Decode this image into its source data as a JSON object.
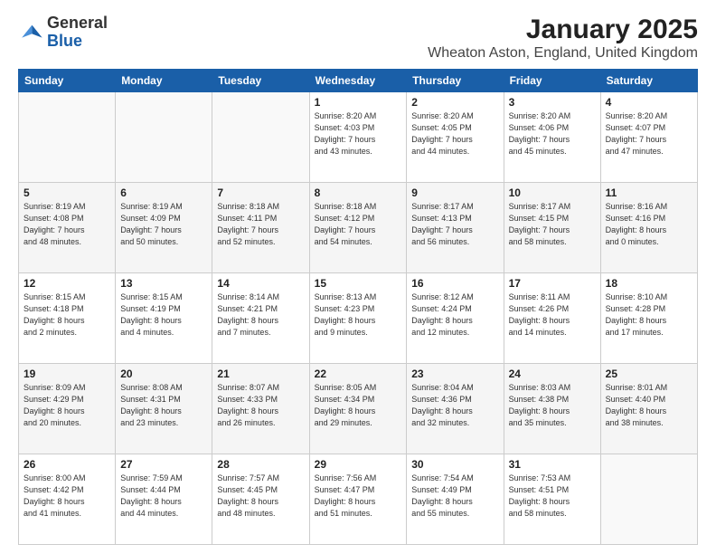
{
  "logo": {
    "general": "General",
    "blue": "Blue"
  },
  "header": {
    "month": "January 2025",
    "location": "Wheaton Aston, England, United Kingdom"
  },
  "weekdays": [
    "Sunday",
    "Monday",
    "Tuesday",
    "Wednesday",
    "Thursday",
    "Friday",
    "Saturday"
  ],
  "weeks": [
    [
      {
        "day": "",
        "info": ""
      },
      {
        "day": "",
        "info": ""
      },
      {
        "day": "",
        "info": ""
      },
      {
        "day": "1",
        "info": "Sunrise: 8:20 AM\nSunset: 4:03 PM\nDaylight: 7 hours\nand 43 minutes."
      },
      {
        "day": "2",
        "info": "Sunrise: 8:20 AM\nSunset: 4:05 PM\nDaylight: 7 hours\nand 44 minutes."
      },
      {
        "day": "3",
        "info": "Sunrise: 8:20 AM\nSunset: 4:06 PM\nDaylight: 7 hours\nand 45 minutes."
      },
      {
        "day": "4",
        "info": "Sunrise: 8:20 AM\nSunset: 4:07 PM\nDaylight: 7 hours\nand 47 minutes."
      }
    ],
    [
      {
        "day": "5",
        "info": "Sunrise: 8:19 AM\nSunset: 4:08 PM\nDaylight: 7 hours\nand 48 minutes."
      },
      {
        "day": "6",
        "info": "Sunrise: 8:19 AM\nSunset: 4:09 PM\nDaylight: 7 hours\nand 50 minutes."
      },
      {
        "day": "7",
        "info": "Sunrise: 8:18 AM\nSunset: 4:11 PM\nDaylight: 7 hours\nand 52 minutes."
      },
      {
        "day": "8",
        "info": "Sunrise: 8:18 AM\nSunset: 4:12 PM\nDaylight: 7 hours\nand 54 minutes."
      },
      {
        "day": "9",
        "info": "Sunrise: 8:17 AM\nSunset: 4:13 PM\nDaylight: 7 hours\nand 56 minutes."
      },
      {
        "day": "10",
        "info": "Sunrise: 8:17 AM\nSunset: 4:15 PM\nDaylight: 7 hours\nand 58 minutes."
      },
      {
        "day": "11",
        "info": "Sunrise: 8:16 AM\nSunset: 4:16 PM\nDaylight: 8 hours\nand 0 minutes."
      }
    ],
    [
      {
        "day": "12",
        "info": "Sunrise: 8:15 AM\nSunset: 4:18 PM\nDaylight: 8 hours\nand 2 minutes."
      },
      {
        "day": "13",
        "info": "Sunrise: 8:15 AM\nSunset: 4:19 PM\nDaylight: 8 hours\nand 4 minutes."
      },
      {
        "day": "14",
        "info": "Sunrise: 8:14 AM\nSunset: 4:21 PM\nDaylight: 8 hours\nand 7 minutes."
      },
      {
        "day": "15",
        "info": "Sunrise: 8:13 AM\nSunset: 4:23 PM\nDaylight: 8 hours\nand 9 minutes."
      },
      {
        "day": "16",
        "info": "Sunrise: 8:12 AM\nSunset: 4:24 PM\nDaylight: 8 hours\nand 12 minutes."
      },
      {
        "day": "17",
        "info": "Sunrise: 8:11 AM\nSunset: 4:26 PM\nDaylight: 8 hours\nand 14 minutes."
      },
      {
        "day": "18",
        "info": "Sunrise: 8:10 AM\nSunset: 4:28 PM\nDaylight: 8 hours\nand 17 minutes."
      }
    ],
    [
      {
        "day": "19",
        "info": "Sunrise: 8:09 AM\nSunset: 4:29 PM\nDaylight: 8 hours\nand 20 minutes."
      },
      {
        "day": "20",
        "info": "Sunrise: 8:08 AM\nSunset: 4:31 PM\nDaylight: 8 hours\nand 23 minutes."
      },
      {
        "day": "21",
        "info": "Sunrise: 8:07 AM\nSunset: 4:33 PM\nDaylight: 8 hours\nand 26 minutes."
      },
      {
        "day": "22",
        "info": "Sunrise: 8:05 AM\nSunset: 4:34 PM\nDaylight: 8 hours\nand 29 minutes."
      },
      {
        "day": "23",
        "info": "Sunrise: 8:04 AM\nSunset: 4:36 PM\nDaylight: 8 hours\nand 32 minutes."
      },
      {
        "day": "24",
        "info": "Sunrise: 8:03 AM\nSunset: 4:38 PM\nDaylight: 8 hours\nand 35 minutes."
      },
      {
        "day": "25",
        "info": "Sunrise: 8:01 AM\nSunset: 4:40 PM\nDaylight: 8 hours\nand 38 minutes."
      }
    ],
    [
      {
        "day": "26",
        "info": "Sunrise: 8:00 AM\nSunset: 4:42 PM\nDaylight: 8 hours\nand 41 minutes."
      },
      {
        "day": "27",
        "info": "Sunrise: 7:59 AM\nSunset: 4:44 PM\nDaylight: 8 hours\nand 44 minutes."
      },
      {
        "day": "28",
        "info": "Sunrise: 7:57 AM\nSunset: 4:45 PM\nDaylight: 8 hours\nand 48 minutes."
      },
      {
        "day": "29",
        "info": "Sunrise: 7:56 AM\nSunset: 4:47 PM\nDaylight: 8 hours\nand 51 minutes."
      },
      {
        "day": "30",
        "info": "Sunrise: 7:54 AM\nSunset: 4:49 PM\nDaylight: 8 hours\nand 55 minutes."
      },
      {
        "day": "31",
        "info": "Sunrise: 7:53 AM\nSunset: 4:51 PM\nDaylight: 8 hours\nand 58 minutes."
      },
      {
        "day": "",
        "info": ""
      }
    ]
  ]
}
